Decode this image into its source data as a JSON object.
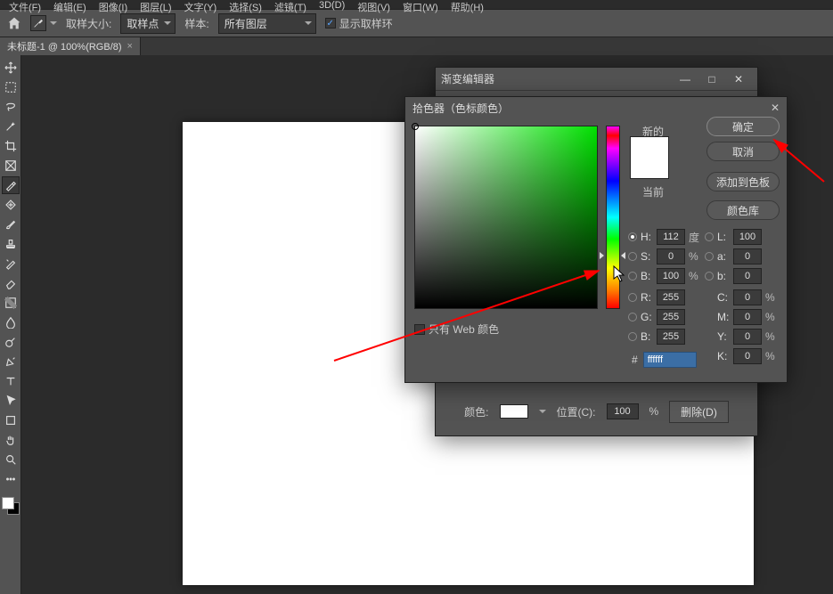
{
  "menu": {
    "items": [
      "文件(F)",
      "编辑(E)",
      "图像(I)",
      "图层(L)",
      "文字(Y)",
      "选择(S)",
      "滤镜(T)",
      "3D(D)",
      "视图(V)",
      "窗口(W)",
      "帮助(H)"
    ]
  },
  "options": {
    "sample_size_label": "取样大小:",
    "sample_size_value": "取样点",
    "sample_label": "样本:",
    "sample_value": "所有图层",
    "show_ring_label": "显示取样环"
  },
  "tab": {
    "title": "未标题-1 @ 100%(RGB/8)",
    "close": "×"
  },
  "grad_dialog": {
    "title": "渐变编辑器",
    "color_label": "颜色:",
    "position_label": "位置(C):",
    "position_value": "100",
    "position_unit": "%",
    "delete_btn": "删除(D)"
  },
  "picker": {
    "title": "拾色器（色标颜色）",
    "new_label": "新的",
    "current_label": "当前",
    "ok": "确定",
    "cancel": "取消",
    "add_swatch": "添加到色板",
    "color_lib": "颜色库",
    "web_only": "只有 Web 颜色",
    "H": {
      "label": "H:",
      "value": "112",
      "unit": "度"
    },
    "S": {
      "label": "S:",
      "value": "0",
      "unit": "%"
    },
    "B": {
      "label": "B:",
      "value": "100",
      "unit": "%"
    },
    "R": {
      "label": "R:",
      "value": "255"
    },
    "G": {
      "label": "G:",
      "value": "255"
    },
    "Bch": {
      "label": "B:",
      "value": "255"
    },
    "L": {
      "label": "L:",
      "value": "100"
    },
    "a": {
      "label": "a:",
      "value": "0"
    },
    "bL": {
      "label": "b:",
      "value": "0"
    },
    "C": {
      "label": "C:",
      "value": "0",
      "unit": "%"
    },
    "M": {
      "label": "M:",
      "value": "0",
      "unit": "%"
    },
    "Y": {
      "label": "Y:",
      "value": "0",
      "unit": "%"
    },
    "K": {
      "label": "K:",
      "value": "0",
      "unit": "%"
    },
    "hash": "#",
    "hex": "ffffff"
  },
  "tools": [
    "move",
    "marquee",
    "lasso",
    "wand",
    "crop",
    "frame",
    "eyedrop",
    "patch",
    "brush",
    "stamp",
    "history",
    "eraser",
    "gradient",
    "blur",
    "dodge",
    "pen",
    "type",
    "path",
    "shape",
    "hand",
    "zoom"
  ]
}
